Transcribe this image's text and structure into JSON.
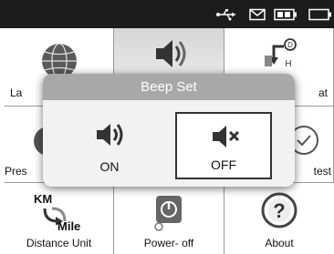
{
  "status_icons": [
    "usb-icon",
    "envelope-icon",
    "battery-icon",
    "battery-icon"
  ],
  "menu": {
    "items": [
      {
        "label": "La",
        "icon": "globe-icon"
      },
      {
        "label": "",
        "icon": "speaker-icon"
      },
      {
        "label": "at",
        "icon": "format-icon"
      },
      {
        "label": "Pres",
        "icon": "pressure-icon"
      },
      {
        "label": "",
        "icon": ""
      },
      {
        "label": "test",
        "icon": "self-test-icon"
      },
      {
        "label": "Distance Unit",
        "icon": "km-mile-icon"
      },
      {
        "label": "Power- off",
        "icon": "power-off-icon"
      },
      {
        "label": "About",
        "icon": "question-icon"
      }
    ],
    "km_text": "KM",
    "mile_text": "Mile"
  },
  "dialog": {
    "title": "Beep Set",
    "options": [
      {
        "label": "ON",
        "icon": "speaker-on-icon",
        "selected": false
      },
      {
        "label": "OFF",
        "icon": "speaker-mute-icon",
        "selected": true
      }
    ]
  }
}
